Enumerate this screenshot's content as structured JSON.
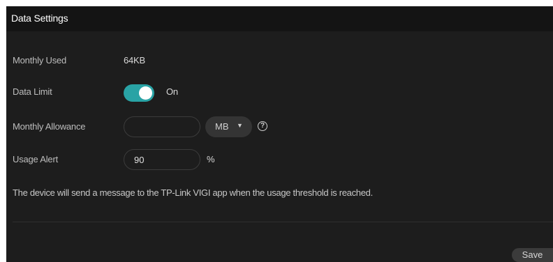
{
  "header": {
    "title": "Data Settings"
  },
  "monthly_used": {
    "label": "Monthly Used",
    "value": "64KB"
  },
  "data_limit": {
    "label": "Data Limit",
    "state": "On",
    "enabled": true,
    "accent_color": "#29a3a5"
  },
  "monthly_allowance": {
    "label": "Monthly Allowance",
    "value": "",
    "unit_selected": "MB",
    "unit_caret": "▼",
    "help_icon": "?"
  },
  "usage_alert": {
    "label": "Usage Alert",
    "value": "90",
    "unit": "%"
  },
  "note": "The device will send a message to the TP-Link VIGI app when the usage threshold is reached.",
  "actions": {
    "save_label": "Save"
  }
}
